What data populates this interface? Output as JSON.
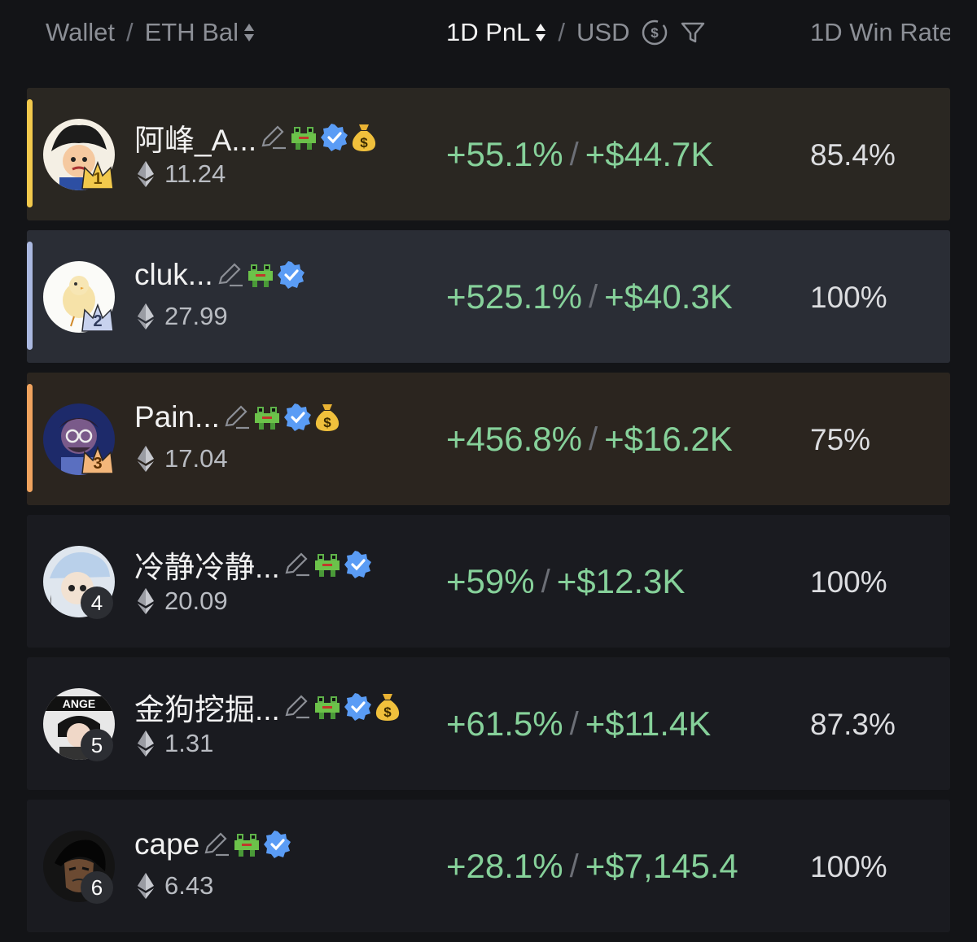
{
  "header": {
    "wallet_label": "Wallet",
    "eth_bal_label": "ETH Bal",
    "pnl_label": "1D PnL",
    "usd_label": "USD",
    "win_rate_label": "1D Win Rate"
  },
  "colors": {
    "positive": "#86d19a",
    "rank1": "#f2c94c",
    "rank2": "#aab8e0",
    "rank3": "#f0a35e"
  },
  "rows": [
    {
      "rank": "1",
      "name": "阿峰_A...",
      "eth": "11.24",
      "pnl_pct": "+55.1%",
      "pnl_usd": "+$44.7K",
      "win_rate": "85.4%",
      "icons": [
        "edit-icon",
        "frog-icon",
        "verified-icon",
        "money-bag-icon"
      ]
    },
    {
      "rank": "2",
      "name": "cluk...",
      "eth": "27.99",
      "pnl_pct": "+525.1%",
      "pnl_usd": "+$40.3K",
      "win_rate": "100%",
      "icons": [
        "edit-icon",
        "frog-icon",
        "verified-icon"
      ]
    },
    {
      "rank": "3",
      "name": "Pain...",
      "eth": "17.04",
      "pnl_pct": "+456.8%",
      "pnl_usd": "+$16.2K",
      "win_rate": "75%",
      "icons": [
        "edit-icon",
        "frog-icon",
        "verified-icon",
        "money-bag-icon"
      ]
    },
    {
      "rank": "4",
      "name": "冷静冷静...",
      "eth": "20.09",
      "pnl_pct": "+59%",
      "pnl_usd": "+$12.3K",
      "win_rate": "100%",
      "icons": [
        "edit-icon",
        "frog-icon",
        "verified-icon"
      ]
    },
    {
      "rank": "5",
      "name": "金狗挖掘...",
      "eth": "1.31",
      "pnl_pct": "+61.5%",
      "pnl_usd": "+$11.4K",
      "win_rate": "87.3%",
      "icons": [
        "edit-icon",
        "frog-icon",
        "verified-icon",
        "money-bag-icon"
      ]
    },
    {
      "rank": "6",
      "name": "cape",
      "eth": "6.43",
      "pnl_pct": "+28.1%",
      "pnl_usd": "+$7,145.4",
      "win_rate": "100%",
      "icons": [
        "edit-icon",
        "frog-icon",
        "verified-icon"
      ]
    }
  ]
}
